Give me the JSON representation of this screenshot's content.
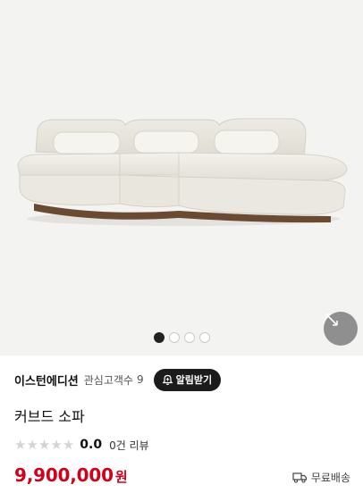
{
  "gallery": {
    "slide_count": 4,
    "active_index": 0,
    "expand_icon": "expand-arrows-icon"
  },
  "brand": {
    "name": "이스턴에디션",
    "fan_label": "관심고객수",
    "fan_count": "9",
    "alarm_label": "알림받기",
    "alarm_icon": "bell-plus-icon"
  },
  "product": {
    "name": "커브드 소파"
  },
  "rating": {
    "stars": 0,
    "max_stars": 5,
    "value": "0.0",
    "review_text": "0건 리뷰"
  },
  "price": {
    "amount": "9,900,000",
    "currency": "원",
    "color": "#d0021b"
  },
  "shipping": {
    "label": "무료배송",
    "icon": "truck-icon"
  }
}
